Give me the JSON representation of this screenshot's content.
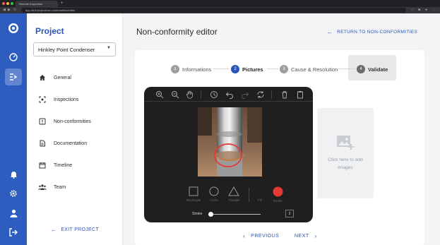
{
  "browser": {
    "tab_title": "Remote Inspection",
    "new_tab_glyph": "+",
    "url": "app.stt.fr/project/non-conformities/editor"
  },
  "rail": {
    "icons": [
      "logo-icon",
      "dashboard-icon",
      "project-list-icon",
      "bell-icon",
      "gear-icon",
      "user-icon",
      "logout-icon"
    ],
    "active": "project-list-icon"
  },
  "project_panel": {
    "title": "Project",
    "selected_project": "Hinkley Point Condenser",
    "nav": [
      {
        "label": "General",
        "icon": "home-icon"
      },
      {
        "label": "Inspections",
        "icon": "inspection-icon"
      },
      {
        "label": "Non-conformities",
        "icon": "alert-icon"
      },
      {
        "label": "Documentation",
        "icon": "document-icon"
      },
      {
        "label": "Timeline",
        "icon": "calendar-icon"
      },
      {
        "label": "Team",
        "icon": "team-icon"
      }
    ],
    "exit_label": "EXIT PROJECT"
  },
  "main": {
    "title": "Non-conformity editor",
    "return_label": "RETURN TO NON-CONFORMITIES",
    "steps": [
      {
        "number": "1",
        "label": "Informations",
        "state": "done"
      },
      {
        "number": "2",
        "label": "Pictures",
        "state": "active"
      },
      {
        "number": "3",
        "label": "Cause & Resolution",
        "state": "pending"
      },
      {
        "number": "4",
        "label": "Validate",
        "state": "pending"
      }
    ],
    "editor": {
      "toolbar_icons": [
        "zoom-in-icon",
        "zoom-out-icon",
        "hand-icon",
        "history-icon",
        "undo-icon",
        "redo-icon",
        "reset-icon",
        "delete-icon",
        "clipboard-icon"
      ],
      "tools": [
        {
          "label": "Rectangle",
          "icon": "rectangle-icon"
        },
        {
          "label": "Circle",
          "icon": "circle-icon"
        },
        {
          "label": "Triangle",
          "icon": "triangle-icon"
        },
        {
          "label": "Fill",
          "icon": "fill-icon"
        },
        {
          "label": "Stroke",
          "icon": "stroke-color-icon"
        }
      ],
      "stroke_label": "Stroke",
      "stroke_value": "3",
      "stroke_color": "#e53935"
    },
    "upload_text": "Click here to add images",
    "prev_label": "PREVIOUS",
    "next_label": "NEXT"
  },
  "colors": {
    "rail": "#2d5dbf",
    "accent": "#2a56b8",
    "step_active": "#2a56b8",
    "step_inactive": "#9e9e9e",
    "stroke_red": "#e53935"
  }
}
